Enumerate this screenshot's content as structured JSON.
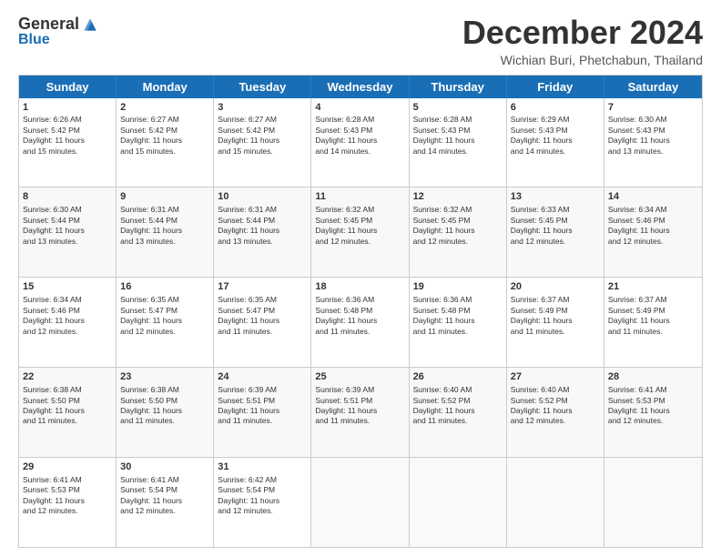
{
  "logo": {
    "general": "General",
    "blue": "Blue"
  },
  "header": {
    "month": "December 2024",
    "location": "Wichian Buri, Phetchabun, Thailand"
  },
  "weekdays": [
    "Sunday",
    "Monday",
    "Tuesday",
    "Wednesday",
    "Thursday",
    "Friday",
    "Saturday"
  ],
  "rows": [
    [
      {
        "day": "1",
        "lines": [
          "Sunrise: 6:26 AM",
          "Sunset: 5:42 PM",
          "Daylight: 11 hours",
          "and 15 minutes."
        ]
      },
      {
        "day": "2",
        "lines": [
          "Sunrise: 6:27 AM",
          "Sunset: 5:42 PM",
          "Daylight: 11 hours",
          "and 15 minutes."
        ]
      },
      {
        "day": "3",
        "lines": [
          "Sunrise: 6:27 AM",
          "Sunset: 5:42 PM",
          "Daylight: 11 hours",
          "and 15 minutes."
        ]
      },
      {
        "day": "4",
        "lines": [
          "Sunrise: 6:28 AM",
          "Sunset: 5:43 PM",
          "Daylight: 11 hours",
          "and 14 minutes."
        ]
      },
      {
        "day": "5",
        "lines": [
          "Sunrise: 6:28 AM",
          "Sunset: 5:43 PM",
          "Daylight: 11 hours",
          "and 14 minutes."
        ]
      },
      {
        "day": "6",
        "lines": [
          "Sunrise: 6:29 AM",
          "Sunset: 5:43 PM",
          "Daylight: 11 hours",
          "and 14 minutes."
        ]
      },
      {
        "day": "7",
        "lines": [
          "Sunrise: 6:30 AM",
          "Sunset: 5:43 PM",
          "Daylight: 11 hours",
          "and 13 minutes."
        ]
      }
    ],
    [
      {
        "day": "8",
        "lines": [
          "Sunrise: 6:30 AM",
          "Sunset: 5:44 PM",
          "Daylight: 11 hours",
          "and 13 minutes."
        ]
      },
      {
        "day": "9",
        "lines": [
          "Sunrise: 6:31 AM",
          "Sunset: 5:44 PM",
          "Daylight: 11 hours",
          "and 13 minutes."
        ]
      },
      {
        "day": "10",
        "lines": [
          "Sunrise: 6:31 AM",
          "Sunset: 5:44 PM",
          "Daylight: 11 hours",
          "and 13 minutes."
        ]
      },
      {
        "day": "11",
        "lines": [
          "Sunrise: 6:32 AM",
          "Sunset: 5:45 PM",
          "Daylight: 11 hours",
          "and 12 minutes."
        ]
      },
      {
        "day": "12",
        "lines": [
          "Sunrise: 6:32 AM",
          "Sunset: 5:45 PM",
          "Daylight: 11 hours",
          "and 12 minutes."
        ]
      },
      {
        "day": "13",
        "lines": [
          "Sunrise: 6:33 AM",
          "Sunset: 5:45 PM",
          "Daylight: 11 hours",
          "and 12 minutes."
        ]
      },
      {
        "day": "14",
        "lines": [
          "Sunrise: 6:34 AM",
          "Sunset: 5:46 PM",
          "Daylight: 11 hours",
          "and 12 minutes."
        ]
      }
    ],
    [
      {
        "day": "15",
        "lines": [
          "Sunrise: 6:34 AM",
          "Sunset: 5:46 PM",
          "Daylight: 11 hours",
          "and 12 minutes."
        ]
      },
      {
        "day": "16",
        "lines": [
          "Sunrise: 6:35 AM",
          "Sunset: 5:47 PM",
          "Daylight: 11 hours",
          "and 12 minutes."
        ]
      },
      {
        "day": "17",
        "lines": [
          "Sunrise: 6:35 AM",
          "Sunset: 5:47 PM",
          "Daylight: 11 hours",
          "and 11 minutes."
        ]
      },
      {
        "day": "18",
        "lines": [
          "Sunrise: 6:36 AM",
          "Sunset: 5:48 PM",
          "Daylight: 11 hours",
          "and 11 minutes."
        ]
      },
      {
        "day": "19",
        "lines": [
          "Sunrise: 6:36 AM",
          "Sunset: 5:48 PM",
          "Daylight: 11 hours",
          "and 11 minutes."
        ]
      },
      {
        "day": "20",
        "lines": [
          "Sunrise: 6:37 AM",
          "Sunset: 5:49 PM",
          "Daylight: 11 hours",
          "and 11 minutes."
        ]
      },
      {
        "day": "21",
        "lines": [
          "Sunrise: 6:37 AM",
          "Sunset: 5:49 PM",
          "Daylight: 11 hours",
          "and 11 minutes."
        ]
      }
    ],
    [
      {
        "day": "22",
        "lines": [
          "Sunrise: 6:38 AM",
          "Sunset: 5:50 PM",
          "Daylight: 11 hours",
          "and 11 minutes."
        ]
      },
      {
        "day": "23",
        "lines": [
          "Sunrise: 6:38 AM",
          "Sunset: 5:50 PM",
          "Daylight: 11 hours",
          "and 11 minutes."
        ]
      },
      {
        "day": "24",
        "lines": [
          "Sunrise: 6:39 AM",
          "Sunset: 5:51 PM",
          "Daylight: 11 hours",
          "and 11 minutes."
        ]
      },
      {
        "day": "25",
        "lines": [
          "Sunrise: 6:39 AM",
          "Sunset: 5:51 PM",
          "Daylight: 11 hours",
          "and 11 minutes."
        ]
      },
      {
        "day": "26",
        "lines": [
          "Sunrise: 6:40 AM",
          "Sunset: 5:52 PM",
          "Daylight: 11 hours",
          "and 11 minutes."
        ]
      },
      {
        "day": "27",
        "lines": [
          "Sunrise: 6:40 AM",
          "Sunset: 5:52 PM",
          "Daylight: 11 hours",
          "and 12 minutes."
        ]
      },
      {
        "day": "28",
        "lines": [
          "Sunrise: 6:41 AM",
          "Sunset: 5:53 PM",
          "Daylight: 11 hours",
          "and 12 minutes."
        ]
      }
    ],
    [
      {
        "day": "29",
        "lines": [
          "Sunrise: 6:41 AM",
          "Sunset: 5:53 PM",
          "Daylight: 11 hours",
          "and 12 minutes."
        ]
      },
      {
        "day": "30",
        "lines": [
          "Sunrise: 6:41 AM",
          "Sunset: 5:54 PM",
          "Daylight: 11 hours",
          "and 12 minutes."
        ]
      },
      {
        "day": "31",
        "lines": [
          "Sunrise: 6:42 AM",
          "Sunset: 5:54 PM",
          "Daylight: 11 hours",
          "and 12 minutes."
        ]
      },
      {
        "day": "",
        "lines": []
      },
      {
        "day": "",
        "lines": []
      },
      {
        "day": "",
        "lines": []
      },
      {
        "day": "",
        "lines": []
      }
    ]
  ]
}
